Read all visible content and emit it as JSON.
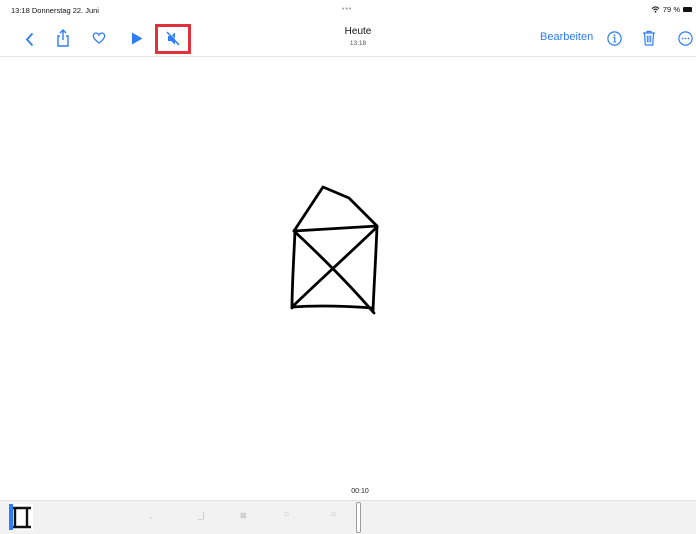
{
  "status": {
    "time_date": "13:18  Donnerstag 22. Juni",
    "dots": "•••",
    "battery": "79 %"
  },
  "header": {
    "title": "Heute",
    "subtitle": "13:18",
    "edit_label": "Bearbeiten"
  },
  "icons": {
    "back": "chevron-left-icon",
    "share": "share-icon",
    "favorite": "heart-icon",
    "play": "play-icon",
    "mute": "speaker-muted-icon",
    "info": "info-icon",
    "delete": "trash-icon",
    "more": "ellipsis-circle-icon",
    "wifi": "wifi-icon"
  },
  "colors": {
    "accent": "#2f7df6",
    "highlight": "#e0323c"
  },
  "timeline": {
    "timecode": "00:10"
  }
}
